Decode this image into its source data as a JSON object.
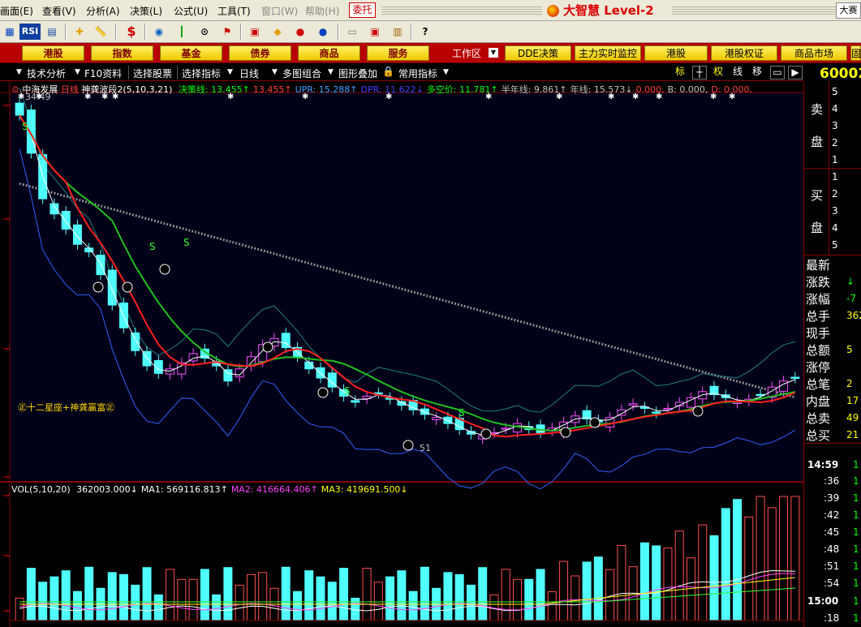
{
  "menu": {
    "items": [
      "画面(E)",
      "查看(V)",
      "分析(A)",
      "决策(L)",
      "公式(U)",
      "工具(T)",
      "窗口(W)",
      "帮助(H)"
    ],
    "entrust": "委托",
    "brand": "大智慧 Level-2",
    "corner": "大赛"
  },
  "toolbar": {
    "rsi": "RSI",
    "dollar": "$"
  },
  "quickbar": {
    "tabs": [
      "港股",
      "指数",
      "基金",
      "债券",
      "商品",
      "服务"
    ],
    "workarea": "工作区",
    "right_tabs": [
      "DDE决策",
      "主力实时监控",
      "港股",
      "港股权证",
      "商品市场",
      "固"
    ]
  },
  "funcbar": {
    "items": [
      "技术分析",
      "F10资料",
      "选择股票",
      "选择指标",
      "日线",
      "多图组合",
      "图形叠加",
      "常用指标"
    ],
    "right_icons": [
      "标",
      "权",
      "线",
      "移"
    ]
  },
  "stock": {
    "code": "60002"
  },
  "main_chart": {
    "name": "中海发展",
    "period": "日线",
    "indicator": "神龚波段2(5,10,3,21)",
    "values": [
      {
        "label": "决策线:",
        "value": "13.455",
        "arrow": "↑",
        "color": "#00ff00"
      },
      {
        "label": "",
        "value": "13.455",
        "arrow": "↑",
        "color": "#ff4040"
      },
      {
        "label": "UPR:",
        "value": "15.288",
        "arrow": "↑",
        "color": "#40a0ff"
      },
      {
        "label": "DPR:",
        "value": "11.622",
        "arrow": "↓",
        "color": "#4040ff"
      },
      {
        "label": "多空价:",
        "value": "11.781",
        "arrow": "↑",
        "color": "#00ff00"
      },
      {
        "label": "半年线:",
        "value": "9.861",
        "arrow": "↑",
        "color": "#c0c0c0"
      },
      {
        "label": "年线:",
        "value": "15.573",
        "arrow": "↓",
        "color": "#c0c0c0"
      },
      {
        "label": "",
        "value": "0.000,",
        "arrow": "",
        "color": "#ff4040"
      },
      {
        "label": "B:",
        "value": "0.000,",
        "arrow": "",
        "color": "#c0c0c0"
      },
      {
        "label": "D:",
        "value": "0.000,",
        "arrow": "",
        "color": "#ff4040"
      }
    ],
    "high_label": "34.49",
    "low_label": "51",
    "legend": "㊣十二星座+神龚赢富㊣",
    "markers": {
      "buy": "S",
      "sell": "㊣"
    }
  },
  "volume_chart": {
    "name": "VOL(5,10,20)",
    "values": [
      {
        "label": "",
        "value": "362003.000",
        "arrow": "↓",
        "color": "#ffffff"
      },
      {
        "label": "MA1:",
        "value": "569116.813",
        "arrow": "↑",
        "color": "#ffffff"
      },
      {
        "label": "MA2:",
        "value": "416664.406",
        "arrow": "↑",
        "color": "#ff40ff"
      },
      {
        "label": "MA3:",
        "value": "419691.500",
        "arrow": "↓",
        "color": "#ffff00"
      }
    ]
  },
  "right_panel": {
    "sell_label": [
      "卖",
      "盘"
    ],
    "buy_label": [
      "买",
      "盘"
    ],
    "sell_levels": [
      "5",
      "4",
      "3",
      "2",
      "1"
    ],
    "buy_levels": [
      "1",
      "2",
      "3",
      "4",
      "5"
    ],
    "quote_rows": [
      {
        "label": "最新",
        "value": ""
      },
      {
        "label": "涨跌",
        "value": "↓"
      },
      {
        "label": "涨幅",
        "value": "-7"
      },
      {
        "label": "总手",
        "value": "362"
      },
      {
        "label": "现手",
        "value": ""
      },
      {
        "label": "总额",
        "value": "5"
      },
      {
        "label": "涨停",
        "value": ""
      },
      {
        "label": "总笔",
        "value": "2"
      },
      {
        "label": "内盘",
        "value": "17"
      },
      {
        "label": "总卖",
        "value": "49"
      },
      {
        "label": "总买",
        "value": "21"
      }
    ],
    "ticks": [
      {
        "time": "14:59",
        "value": "1"
      },
      {
        "time": ":36",
        "value": "1"
      },
      {
        "time": ":39",
        "value": "1"
      },
      {
        "time": ":42",
        "value": "1"
      },
      {
        "time": ":45",
        "value": "1"
      },
      {
        "time": ":48",
        "value": "1"
      },
      {
        "time": ":51",
        "value": "1"
      },
      {
        "time": ":54",
        "value": "1"
      },
      {
        "time": "15:00",
        "value": "1"
      },
      {
        "time": ":18",
        "value": "1"
      }
    ]
  },
  "colors": {
    "up": "#ff50ff",
    "down": "#50ffff",
    "ma_white": "#ffffff",
    "ma_green": "#20c020",
    "ma_red": "#ff2020",
    "ma_gray": "#909090",
    "band": "#3060ff",
    "grid": "#800000"
  },
  "chart_data": {
    "type": "candlestick",
    "note_close_approx": [
      33.5,
      31.0,
      28.0,
      27.0,
      26.0,
      25.0,
      24.5,
      23.0,
      21.0,
      19.5,
      18.0,
      17.0,
      16.5,
      16.8,
      17.2,
      17.8,
      17.5,
      17.0,
      16.0,
      16.8,
      17.6,
      18.4,
      18.8,
      18.2,
      17.6,
      16.8,
      16.2,
      15.6,
      15.0,
      14.6,
      15.0,
      15.2,
      14.8,
      14.4,
      14.1,
      13.8,
      13.6,
      13.2,
      12.8,
      12.5,
      12.4,
      12.6,
      12.9,
      13.2,
      12.8,
      12.6,
      12.9,
      13.3,
      13.7,
      13.5,
      13.3,
      13.6,
      14.1,
      14.5,
      14.2,
      13.9,
      14.2,
      14.6,
      14.9,
      15.3,
      15.1,
      14.9,
      14.6,
      14.8,
      15.1,
      15.6,
      16.0,
      16.2
    ]
  }
}
